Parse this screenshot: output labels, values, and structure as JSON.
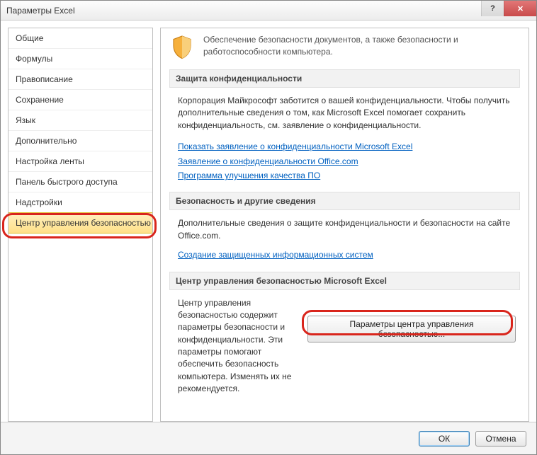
{
  "window": {
    "title": "Параметры Excel"
  },
  "sidebar": {
    "items": [
      {
        "label": "Общие"
      },
      {
        "label": "Формулы"
      },
      {
        "label": "Правописание"
      },
      {
        "label": "Сохранение"
      },
      {
        "label": "Язык"
      },
      {
        "label": "Дополнительно"
      },
      {
        "label": "Настройка ленты"
      },
      {
        "label": "Панель быстрого доступа"
      },
      {
        "label": "Надстройки"
      },
      {
        "label": "Центр управления безопасностью"
      }
    ]
  },
  "main": {
    "intro": "Обеспечение безопасности документов, а также безопасности и работоспособности компьютера.",
    "privacy": {
      "header": "Защита конфиденциальности",
      "text": "Корпорация Майкрософт заботится о вашей конфиденциальности. Чтобы получить дополнительные сведения о том, как Microsoft Excel помогает сохранить конфиденциальность, см. заявление о конфиденциальности.",
      "links": [
        "Показать заявление о конфиденциальности Microsoft Excel",
        "Заявление о конфиденциальности Office.com",
        "Программа улучшения качества ПО"
      ]
    },
    "security": {
      "header": "Безопасность и другие сведения",
      "text": "Дополнительные сведения о защите конфиденциальности и безопасности на сайте Office.com.",
      "link": "Создание защищенных информационных систем"
    },
    "trust": {
      "header": "Центр управления безопасностью Microsoft Excel",
      "desc": "Центр управления безопасностью содержит параметры безопасности и конфиденциальности. Эти параметры помогают обеспечить безопасность компьютера. Изменять их не рекомендуется.",
      "button": "Параметры центра управления безопасностью..."
    }
  },
  "footer": {
    "ok": "ОК",
    "cancel": "Отмена"
  }
}
